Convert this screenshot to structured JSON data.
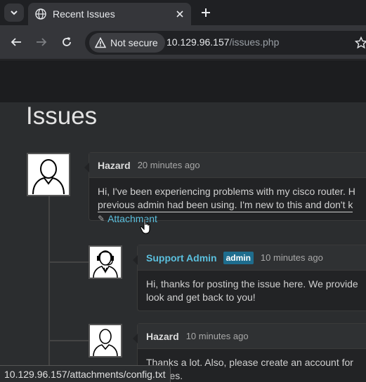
{
  "browser": {
    "tab_title": "Recent Issues",
    "security_label": "Not secure",
    "url_host": "10.129.96.157",
    "url_path": "/issues.php",
    "status_url": "10.129.96.157/attachments/config.txt"
  },
  "page": {
    "title": "Issues"
  },
  "comments": [
    {
      "author": "Hazard",
      "time": "20 minutes ago",
      "line1": "Hi, I've been experiencing problems with my cisco router. H",
      "line2": "previous admin had been using. I'm new to this and don't k",
      "attachment_label": "Attachment"
    },
    {
      "author": "Support Admin",
      "badge": "admin",
      "time": "10 minutes ago",
      "line1": "Hi, thanks for posting the issue here. We provide",
      "line2": "look and get back to you!"
    },
    {
      "author": "Hazard",
      "time": "10 minutes ago",
      "line1": "Thanks a lot. Also, please create an account for",
      "line2": "the files."
    }
  ],
  "icons": {
    "tab_menu": "chevron-down-icon",
    "globe": "globe-icon",
    "close": "close-icon",
    "new_tab": "plus-icon",
    "back": "arrow-left-icon",
    "forward": "arrow-right-icon",
    "reload": "reload-icon",
    "warning": "warning-icon",
    "bookmark": "star-icon",
    "paperclip": "paperclip-icon",
    "cursor": "hand-pointer-icon"
  }
}
